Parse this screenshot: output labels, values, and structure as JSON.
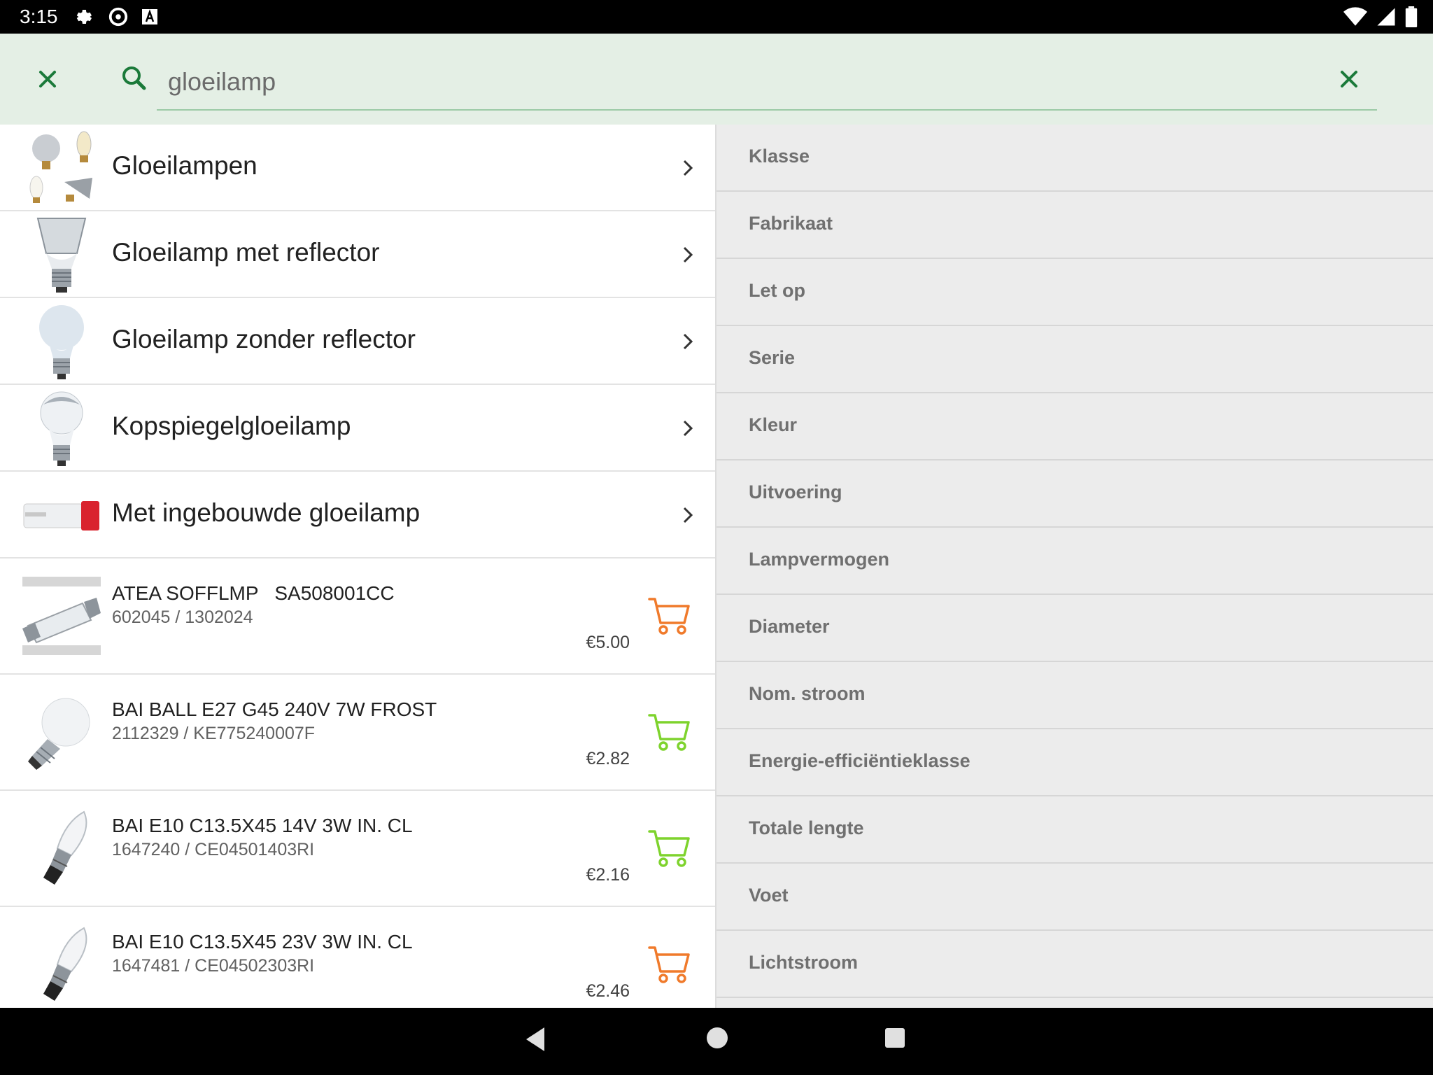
{
  "status_bar": {
    "time": "3:15",
    "left_icons": [
      "gear-icon",
      "sync-icon",
      "a-box-icon"
    ],
    "right_icons": [
      "wifi-icon",
      "signal-icon",
      "battery-icon"
    ]
  },
  "search": {
    "value": "gloeilamp",
    "placeholder": ""
  },
  "categories": [
    {
      "label": "Gloeilampen",
      "thumb": "assorted-bulbs"
    },
    {
      "label": "Gloeilamp met reflector",
      "thumb": "reflector-bulb"
    },
    {
      "label": "Gloeilamp zonder reflector",
      "thumb": "frosted-bulb"
    },
    {
      "label": "Kopspiegelgloeilamp",
      "thumb": "mirror-bulb"
    },
    {
      "label": "Met ingebouwde gloeilamp",
      "thumb": "switch-lamp"
    }
  ],
  "products": [
    {
      "name": "ATEA SOFFLMP   SA508001CC",
      "code": "602045 / 1302024",
      "price": "€5.00",
      "cart_color": "#f07a2b",
      "thumb": "festoon-bulb"
    },
    {
      "name": "BAI BALL E27 G45 240V 7W FROST",
      "code": "2112329 / KE775240007F",
      "price": "€2.82",
      "cart_color": "#7ed32d",
      "thumb": "ball-bulb"
    },
    {
      "name": "BAI E10 C13.5X45 14V 3W IN. CL",
      "code": "1647240 / CE04501403RI",
      "price": "€2.16",
      "cart_color": "#7ed32d",
      "thumb": "candle-bulb"
    },
    {
      "name": "BAI E10 C13.5X45 23V 3W IN. CL",
      "code": "1647481 / CE04502303RI",
      "price": "€2.46",
      "cart_color": "#f07a2b",
      "thumb": "candle-bulb"
    }
  ],
  "filters": [
    "Klasse",
    "Fabrikaat",
    "Let op",
    "Serie",
    "Kleur",
    "Uitvoering",
    "Lampvermogen",
    "Diameter",
    "Nom. stroom",
    "Energie-efficiëntieklasse",
    "Totale lengte",
    "Voet",
    "Lichtstroom"
  ],
  "colors": {
    "accent": "#1b7a3a",
    "search_bg": "#e4efe5",
    "filter_bg": "#ececec",
    "cart_orange": "#f07a2b",
    "cart_green": "#7ed32d"
  }
}
